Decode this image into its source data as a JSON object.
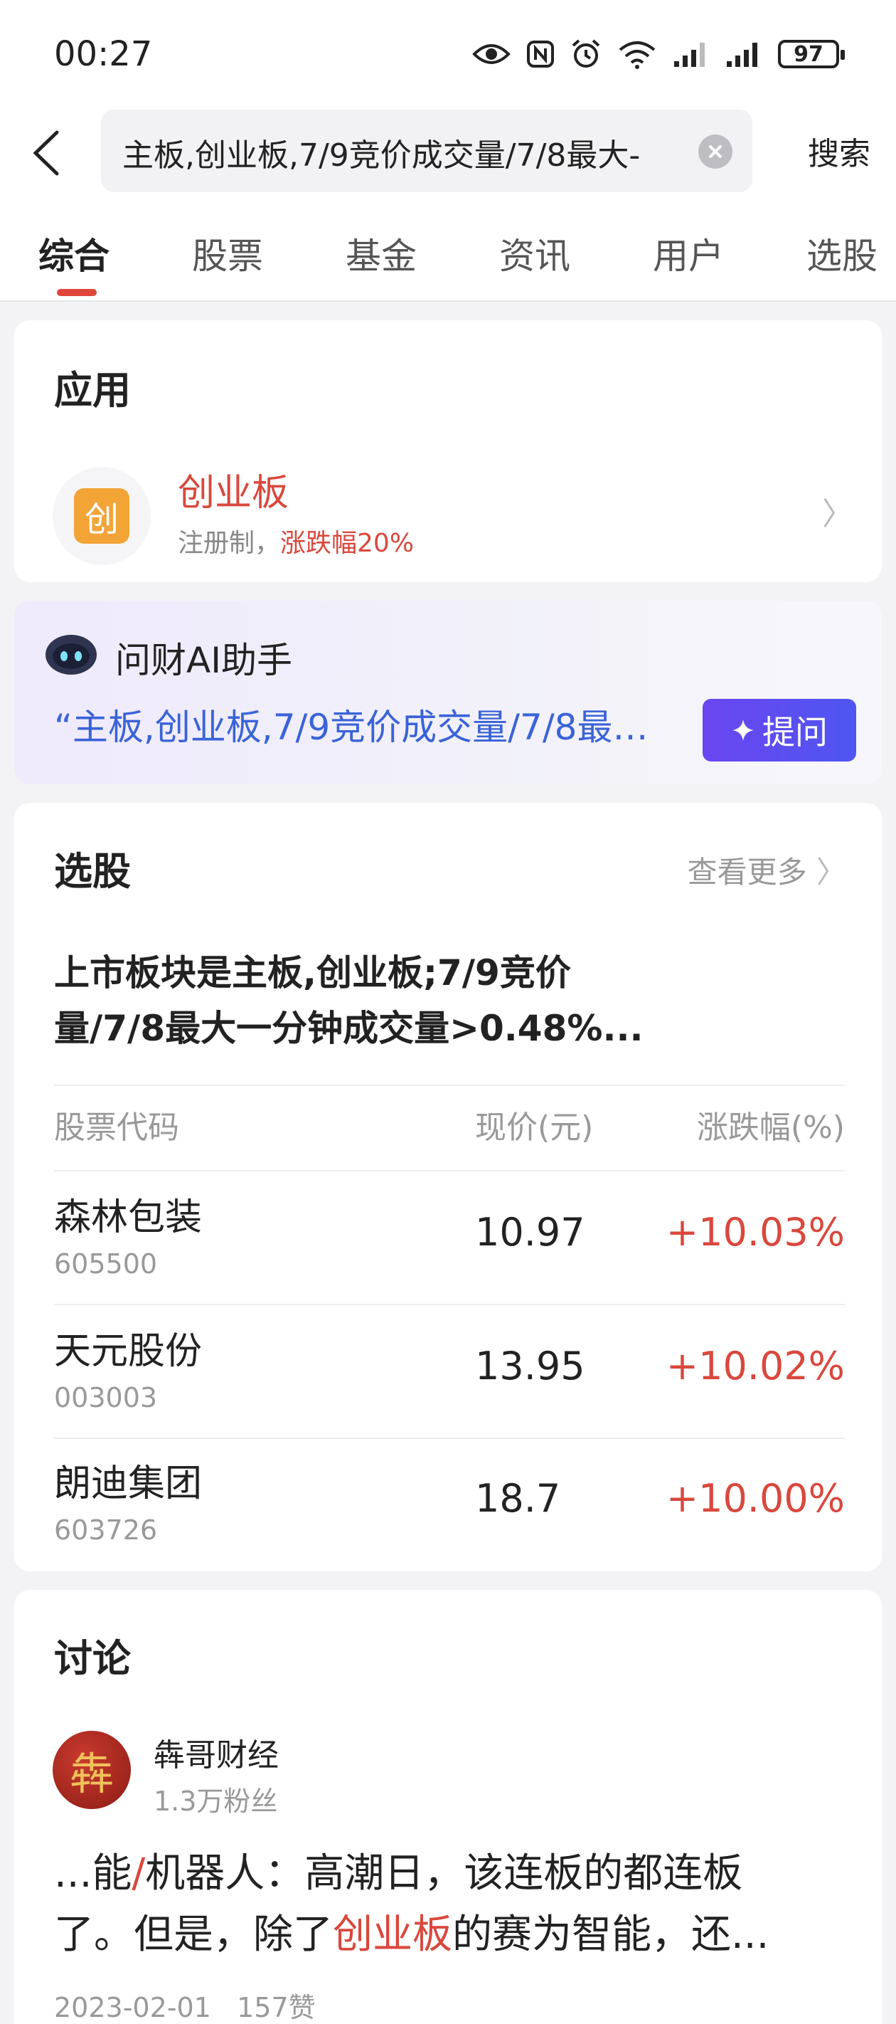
{
  "status_bar": {
    "time": "00:27",
    "battery": "97"
  },
  "search": {
    "query": "主板,创业板,7/9竞价成交量/7/8最大-",
    "button": "搜索"
  },
  "tabs": [
    "综合",
    "股票",
    "基金",
    "资讯",
    "用户",
    "选股"
  ],
  "app_section": {
    "title": "应用",
    "item": {
      "icon_char": "创",
      "name": "创业板",
      "desc_prefix": "注册制，",
      "desc_highlight": "涨跌幅20%"
    }
  },
  "ai_assistant": {
    "title": "问财AI助手",
    "query": "“主板,创业板,7/9竞价成交量/7/8最…",
    "ask_button": "提问"
  },
  "stock_picker": {
    "title": "选股",
    "more": "查看更多",
    "criteria_line1": "上市板块是主板,创业板;7/9竞价",
    "criteria_line2": "量/7/8最大一分钟成交量>0.48%...",
    "headers": {
      "code": "股票代码",
      "price": "现价(元)",
      "change": "涨跌幅(%)"
    },
    "rows": [
      {
        "name": "森林包装",
        "code": "605500",
        "price": "10.97",
        "change": "+10.03%"
      },
      {
        "name": "天元股份",
        "code": "003003",
        "price": "13.95",
        "change": "+10.02%"
      },
      {
        "name": "朗迪集团",
        "code": "603726",
        "price": "18.7",
        "change": "+10.00%"
      }
    ]
  },
  "discussion": {
    "title": "讨论",
    "author": "犇哥财经",
    "avatar_char": "犇",
    "fans": "1.3万粉丝",
    "line1_a": "...能",
    "line1_slash": "/",
    "line1_b": "机器人：高潮日，该连板的都连板",
    "line2_a": "了。但是，除了",
    "line2_highlight": "创业板",
    "line2_b": "的赛为智能，还...",
    "date": "2023-02-01",
    "likes": "157赞"
  },
  "colors": {
    "accent_red": "#d9483d",
    "ai_blue": "#3a63d8",
    "ask_button": "#5a4ef0"
  }
}
